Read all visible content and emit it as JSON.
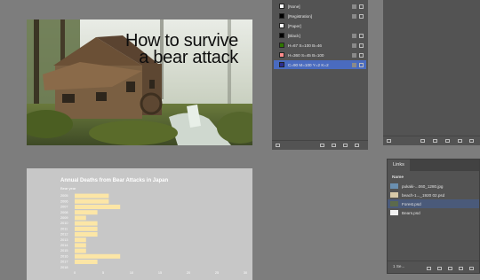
{
  "colors": {
    "app_background": "#7d7d7d",
    "panel_background": "#535353",
    "selection": "#4a6bbf",
    "bar_fill": "#fce6a6",
    "chart_background": "#c7c7c7"
  },
  "document": {
    "page1": {
      "headline": "How to survive a bear attack",
      "image": "forest-watermill-photo"
    }
  },
  "chart_data": {
    "type": "bar",
    "orientation": "horizontal",
    "title": "Annual Deaths from Bear Attacks in Japan",
    "subtitle": "Bear year",
    "categories": [
      "2005",
      "2006",
      "2007",
      "2008",
      "2009",
      "2010",
      "2011",
      "2012",
      "2013",
      "2014",
      "2015",
      "2016",
      "2017",
      "2018"
    ],
    "values": [
      6,
      6,
      8,
      4,
      2,
      4,
      4,
      4,
      2,
      2,
      2,
      8,
      4,
      0
    ],
    "xlim": [
      0,
      30
    ],
    "xticks": [
      "0",
      "5",
      "10",
      "15",
      "20",
      "25",
      "30"
    ]
  },
  "swatches": {
    "items": [
      {
        "label": "[None]",
        "color": "#ffffff",
        "icon": "none-swatch-icon"
      },
      {
        "label": "[Registration]",
        "color": "#000000",
        "icon": "registration-icon"
      },
      {
        "label": "[Paper]",
        "color": "#ffffff",
        "icon": ""
      },
      {
        "label": "[Black]",
        "color": "#000000",
        "icon": "process-color-icon"
      },
      {
        "label": "H=67 S=100 B=46",
        "color": "#2f7600",
        "icon": "process-color-icon"
      },
      {
        "label": "H=360 S=45 B=100",
        "color": "#ff8c8c",
        "icon": "process-color-icon"
      },
      {
        "label": "C=90 M=100 Y=2 K=2",
        "color": "#2c2f8f",
        "icon": "process-color-icon",
        "selected": true
      }
    ]
  },
  "links": {
    "tab": "Links",
    "column_name": "Name",
    "items": [
      {
        "name": "pukaki-...060_1280.jpg",
        "thumb": "#6a8fb0"
      },
      {
        "name": "beach-1..._1920 02.psd",
        "thumb": "#d8c9a8"
      },
      {
        "name": "Forest.psd",
        "thumb": "#5c6a4c",
        "selected": true
      },
      {
        "name": "Bears.psd",
        "thumb": "#f2f2f2"
      }
    ],
    "footer_count": "1 Se..."
  }
}
